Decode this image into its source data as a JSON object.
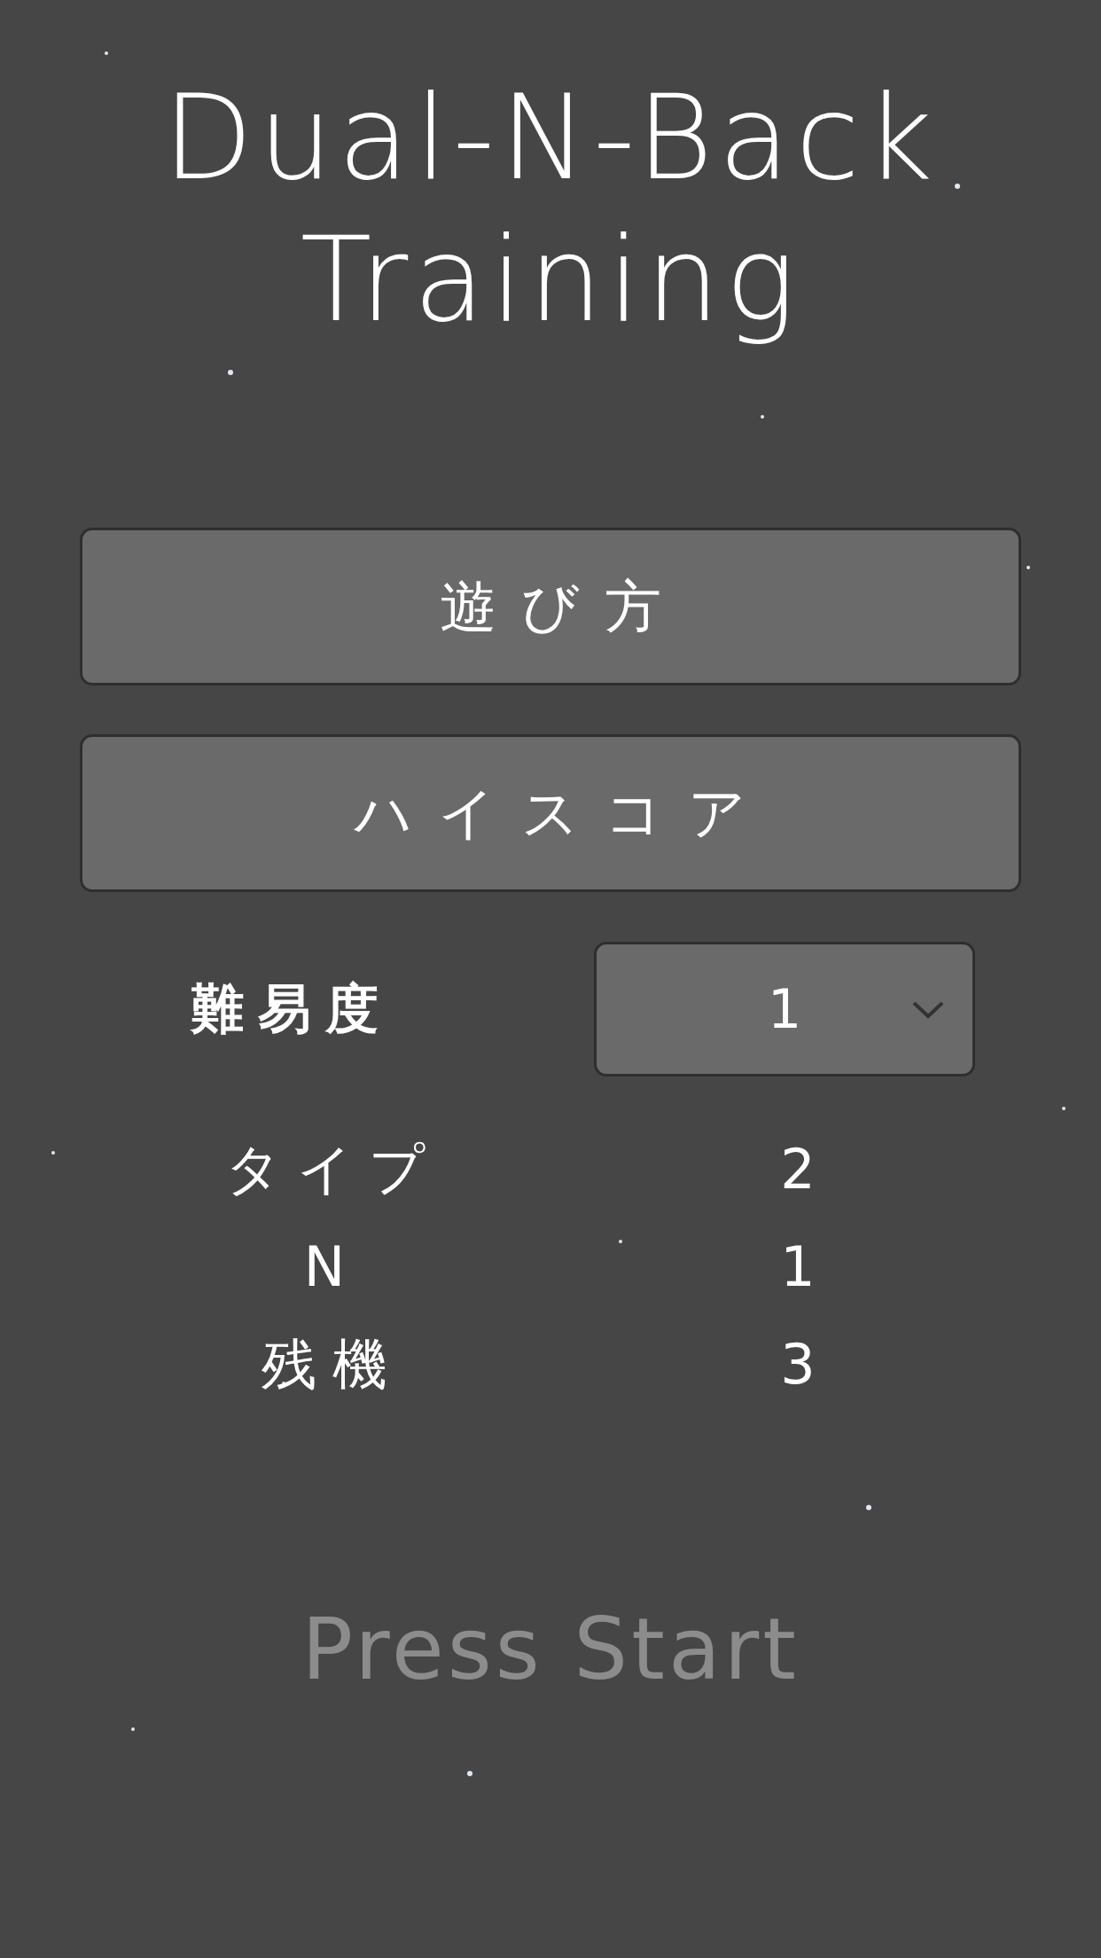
{
  "title": [
    "Dual-N-Back",
    "Training"
  ],
  "buttons": [
    "遊び方",
    "ハイスコア"
  ],
  "difficulty": {
    "label": "難易度",
    "value": "1"
  },
  "stats": [
    {
      "label": "タイプ",
      "value": "2"
    },
    {
      "label": "N",
      "value": "1"
    },
    {
      "label": "残機",
      "value": "3"
    }
  ],
  "start": "Press Start"
}
